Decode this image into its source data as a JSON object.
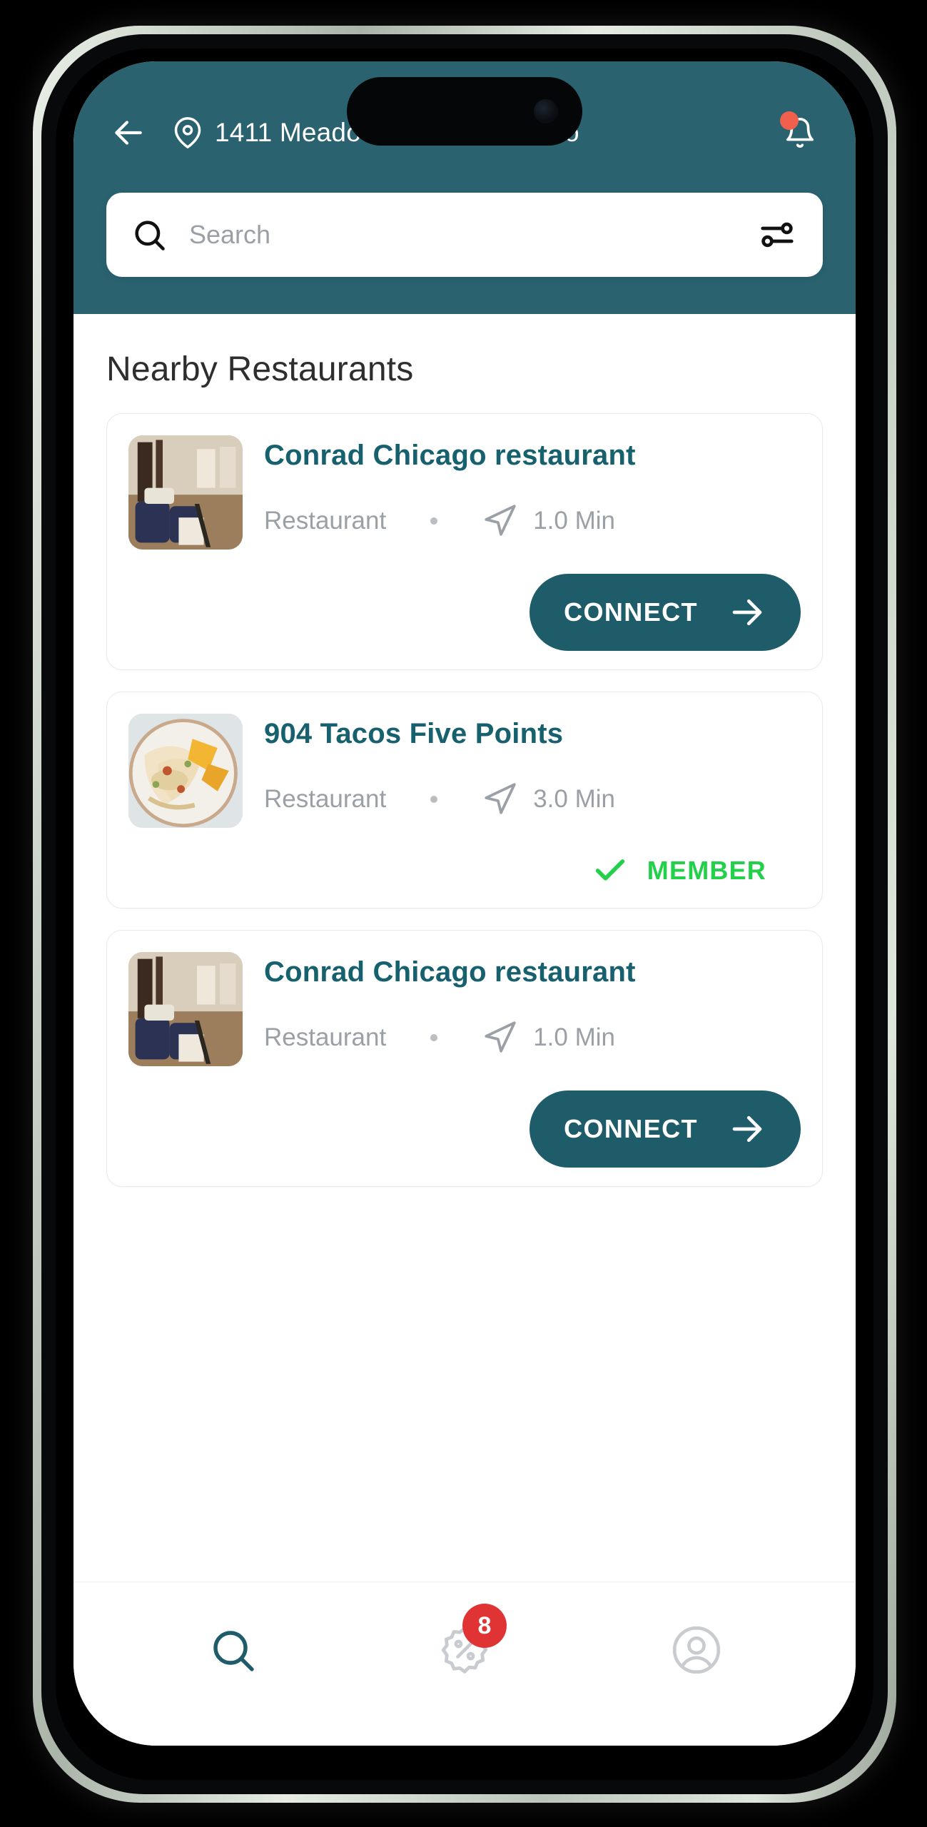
{
  "header": {
    "back_icon": "arrow-left-icon",
    "location_icon": "map-pin-icon",
    "address": "1411 Meadow Drive, Earlsboro",
    "bell_icon": "bell-icon",
    "has_notification_dot": true,
    "bg_color": "#2a6270"
  },
  "search": {
    "icon": "search-icon",
    "value": "",
    "placeholder": "Search",
    "filter_icon": "filter-sliders-icon"
  },
  "main": {
    "section_title": "Nearby Restaurants"
  },
  "restaurants": [
    {
      "name": "Conrad Chicago restaurant",
      "category": "Restaurant",
      "distance": "1.0 Min",
      "nav_icon": "navigation-arrow-icon",
      "action_type": "connect",
      "action_label": "CONNECT",
      "action_icon": "arrow-right-icon",
      "thumb": "restaurant-interior"
    },
    {
      "name": "904 Tacos Five Points",
      "category": "Restaurant",
      "distance": "3.0 Min",
      "nav_icon": "navigation-arrow-icon",
      "action_type": "member",
      "action_label": "MEMBER",
      "action_icon": "check-icon",
      "thumb": "taco-plate"
    },
    {
      "name": "Conrad Chicago restaurant",
      "category": "Restaurant",
      "distance": "1.0 Min",
      "nav_icon": "navigation-arrow-icon",
      "action_type": "connect",
      "action_label": "CONNECT",
      "action_icon": "arrow-right-icon",
      "thumb": "restaurant-interior"
    }
  ],
  "bottom_nav": [
    {
      "icon": "search-icon",
      "active": true,
      "badge": null
    },
    {
      "icon": "discount-tag-icon",
      "active": false,
      "badge": "8"
    },
    {
      "icon": "user-profile-icon",
      "active": false,
      "badge": null
    }
  ],
  "colors": {
    "teal": "#2a6270",
    "teal_button": "#1e5c6a",
    "title_teal": "#17606e",
    "member_green": "#22d04a",
    "badge_red": "#e03434",
    "notification_red": "#f0604d",
    "muted_text": "#9aa0a6"
  }
}
